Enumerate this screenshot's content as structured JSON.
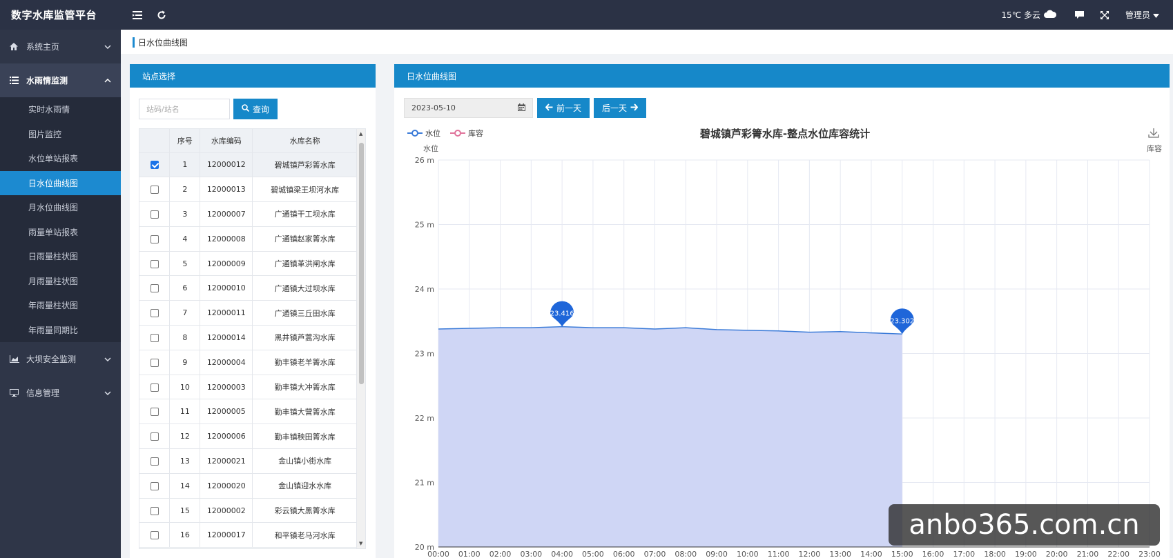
{
  "app": {
    "title": "数字水库监管平台"
  },
  "topbar": {
    "weather": "15℃ 多云",
    "user": "管理员"
  },
  "sidebar": {
    "groups": [
      {
        "label": "系统主页"
      },
      {
        "label": "水雨情监测"
      },
      {
        "label": "大坝安全监测"
      },
      {
        "label": "信息管理"
      }
    ],
    "subitems": [
      {
        "label": "实时水雨情"
      },
      {
        "label": "图片监控"
      },
      {
        "label": "水位单站报表"
      },
      {
        "label": "日水位曲线图"
      },
      {
        "label": "月水位曲线图"
      },
      {
        "label": "雨量单站报表"
      },
      {
        "label": "日雨量柱状图"
      },
      {
        "label": "月雨量柱状图"
      },
      {
        "label": "年雨量柱状图"
      },
      {
        "label": "年雨量同期比"
      }
    ]
  },
  "breadcrumb": {
    "current": "日水位曲线图"
  },
  "left_panel": {
    "title": "站点选择",
    "search_placeholder": "站码/站名",
    "search_button": "查询",
    "columns": [
      "序号",
      "水库编码",
      "水库名称"
    ],
    "rows": [
      {
        "no": "1",
        "code": "12000012",
        "name": "碧城镇芦彩箐水库",
        "checked": true
      },
      {
        "no": "2",
        "code": "12000013",
        "name": "碧城镇梁王坝河水库",
        "checked": false
      },
      {
        "no": "3",
        "code": "12000007",
        "name": "广通镇干工坝水库",
        "checked": false
      },
      {
        "no": "4",
        "code": "12000008",
        "name": "广通镇赵家箐水库",
        "checked": false
      },
      {
        "no": "5",
        "code": "12000009",
        "name": "广通镇革洪闸水库",
        "checked": false
      },
      {
        "no": "6",
        "code": "12000010",
        "name": "广通镇大过坝水库",
        "checked": false
      },
      {
        "no": "7",
        "code": "12000011",
        "name": "广通镇三丘田水库",
        "checked": false
      },
      {
        "no": "8",
        "code": "12000014",
        "name": "黑井镇芦蒿沟水库",
        "checked": false
      },
      {
        "no": "9",
        "code": "12000004",
        "name": "勤丰镇老羊箐水库",
        "checked": false
      },
      {
        "no": "10",
        "code": "12000003",
        "name": "勤丰镇大冲箐水库",
        "checked": false
      },
      {
        "no": "11",
        "code": "12000005",
        "name": "勤丰镇大营箐水库",
        "checked": false
      },
      {
        "no": "12",
        "code": "12000006",
        "name": "勤丰镇秧田箐水库",
        "checked": false
      },
      {
        "no": "13",
        "code": "12000021",
        "name": "金山镇小街水库",
        "checked": false
      },
      {
        "no": "14",
        "code": "12000020",
        "name": "金山镇迎水水库",
        "checked": false
      },
      {
        "no": "15",
        "code": "12000002",
        "name": "彩云镇大黑箐水库",
        "checked": false
      },
      {
        "no": "16",
        "code": "12000017",
        "name": "和平镇老马河水库",
        "checked": false
      }
    ]
  },
  "right_panel": {
    "title": "日水位曲线图",
    "date": "2023-05-10",
    "prev_button": "前一天",
    "next_button": "后一天"
  },
  "chart_data": {
    "type": "area",
    "title": "碧城镇芦彩箐水库-整点水位库容统计",
    "legend": [
      "水位",
      "库容"
    ],
    "legend_position": "top-left",
    "ylabel_left": "水位",
    "ylabel_right": "库容",
    "y_unit": "m",
    "ylim": [
      20,
      26
    ],
    "yticks": [
      "20 m",
      "21 m",
      "22 m",
      "23 m",
      "24 m",
      "25 m",
      "26 m"
    ],
    "x": [
      "00:00",
      "01:00",
      "02:00",
      "03:00",
      "04:00",
      "05:00",
      "06:00",
      "07:00",
      "08:00",
      "09:00",
      "10:00",
      "11:00",
      "12:00",
      "13:00",
      "14:00",
      "15:00",
      "16:00",
      "17:00",
      "18:00",
      "19:00",
      "20:00",
      "21:00",
      "22:00",
      "23:00"
    ],
    "series": [
      {
        "name": "水位",
        "values": [
          23.38,
          23.39,
          23.4,
          23.4,
          23.416,
          23.4,
          23.4,
          23.38,
          23.4,
          23.37,
          23.36,
          23.35,
          23.33,
          23.34,
          23.32,
          23.302
        ],
        "color": "#3b7bd8",
        "fill": "#cfd6f5"
      }
    ],
    "markers": [
      {
        "label": "23.416",
        "x": "04:00",
        "value": 23.416
      },
      {
        "label": "23.302",
        "x": "15:00",
        "value": 23.302
      }
    ],
    "grid": true
  },
  "watermark": "anbo365.com.cn"
}
